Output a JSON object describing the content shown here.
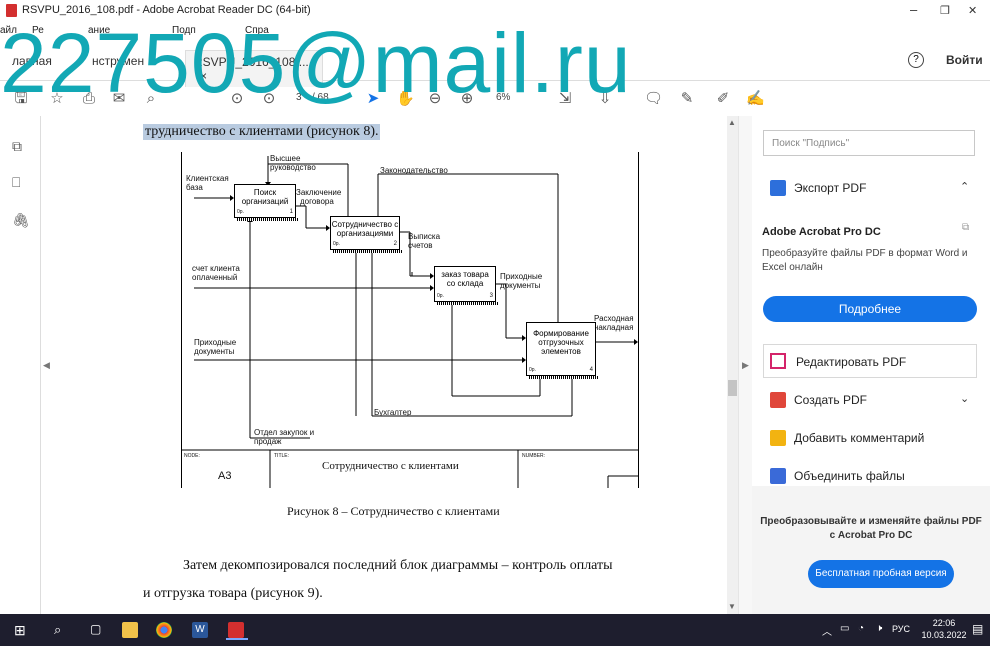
{
  "window": {
    "title": "RSVPU_2016_108.pdf - Adobe Acrobat Reader DC (64-bit)",
    "minimize": "–",
    "maximize": "❐",
    "close": "✕"
  },
  "menu": {
    "items": [
      "айл",
      "Ре",
      "ание",
      "Подп",
      "Спра"
    ]
  },
  "tabs": {
    "home": "лавная",
    "tools": "нструмен",
    "document": "RSVPU_2016_108....",
    "doc_close": "×",
    "help": "?",
    "login": "Войти"
  },
  "toolbar": {
    "page_current": "3",
    "page_total": "/ 68",
    "zoom": "6%"
  },
  "watermark": "227505@mail.ru",
  "document": {
    "top_line": "трудничество с клиентами (рисунок 8).",
    "caption": "Рисунок 8 – Сотрудничество с клиентами",
    "para1": "Затем декомпозировался последний блок диаграммы – контроль оплаты",
    "para2": "и отгрузка товара (рисунок 9)."
  },
  "diagram": {
    "inputs": {
      "client_base_1": "Клиентская",
      "client_base_2": "база",
      "client_invoice_1": "счет клиента",
      "client_invoice_2": "оплаченный",
      "incoming_docs_1": "Приходные",
      "incoming_docs_2": "документы"
    },
    "controls": {
      "top_mgmt_1": "Высшее",
      "top_mgmt_2": "руководство",
      "legislation": "Законодательство"
    },
    "mechanisms": {
      "accountant": "Бухгалтер",
      "purchasing_1": "Отдел закупок и",
      "purchasing_2": "продаж"
    },
    "intermediate": {
      "contract_1": "Заключение",
      "contract_2": "договора",
      "invoice_1": "Выписка",
      "invoice_2": "счетов",
      "incoming_1": "Приходные",
      "incoming_2": "документы"
    },
    "outputs": {
      "waybill_1": "Расходная",
      "waybill_2": "накладная"
    },
    "blocks": [
      {
        "l1": "Поиск",
        "l2": "организаций",
        "num": "1"
      },
      {
        "l1": "Сотрудничество с",
        "l2": "организациями",
        "num": "2"
      },
      {
        "l1": "заказ товара",
        "l2": "со склада",
        "num": "3"
      },
      {
        "l1": "Формирование",
        "l2": "отгрузочных",
        "l3": "элементов",
        "num": "4"
      }
    ],
    "block_tag": "0р.",
    "frame": {
      "node_label": "NODE:",
      "node_value": "A3",
      "title_label": "TITLE:",
      "title_value": "Сотрудничество с клиентами",
      "number_label": "NUMBER:"
    }
  },
  "right_panel": {
    "search_placeholder": "Поиск \"Подпись\"",
    "export_pdf": "Экспорт PDF",
    "promo_title": "Adobe Acrobat Pro DC",
    "promo_text_1": "Преобразуйте файлы PDF в формат Word и",
    "promo_text_2": "Excel онлайн",
    "more_button": "Подробнее",
    "edit_pdf": "Редактировать PDF",
    "create_pdf": "Создать PDF",
    "add_comment": "Добавить комментарий",
    "combine": "Объединить файлы",
    "bottom_text_1": "Преобразовывайте и изменяйте файлы PDF",
    "bottom_text_2": "с Acrobat Pro DC",
    "trial_button": "Бесплатная пробная версия"
  },
  "taskbar": {
    "lang": "РУС",
    "time": "22:06",
    "date": "10.03.2022"
  },
  "colors": {
    "accent": "#1473e6",
    "watermark": "#12a8b5",
    "pdf_red": "#d32f2f"
  }
}
